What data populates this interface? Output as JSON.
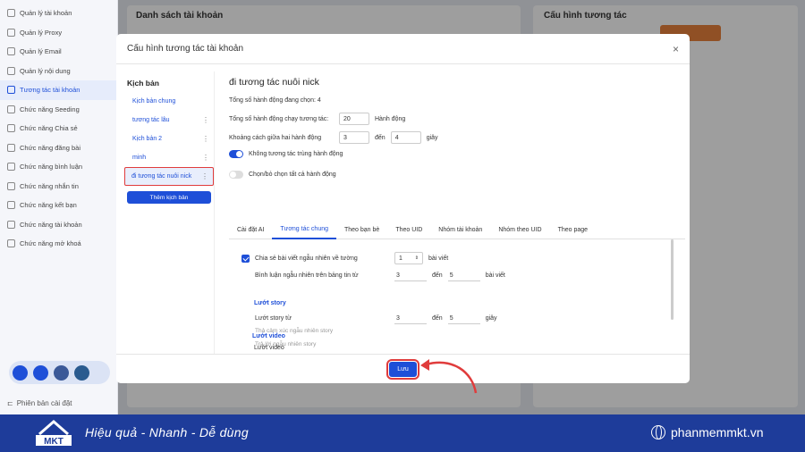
{
  "sidebar": {
    "items": [
      {
        "label": "Quản lý tài khoản",
        "icon": "user-icon"
      },
      {
        "label": "Quản lý Proxy",
        "icon": "proxy-icon"
      },
      {
        "label": "Quản lý Email",
        "icon": "mail-icon"
      },
      {
        "label": "Quản lý nội dung",
        "icon": "content-icon"
      },
      {
        "label": "Tương tác tài khoản",
        "icon": "interaction-icon",
        "active": true
      },
      {
        "label": "Chức năng Seeding",
        "icon": "seeding-icon"
      },
      {
        "label": "Chức năng Chia sẻ",
        "icon": "share-icon"
      },
      {
        "label": "Chức năng đăng bài",
        "icon": "post-icon"
      },
      {
        "label": "Chức năng bình luận",
        "icon": "comment-icon"
      },
      {
        "label": "Chức năng nhắn tin",
        "icon": "message-icon"
      },
      {
        "label": "Chức năng kết bạn",
        "icon": "friend-icon"
      },
      {
        "label": "Chức năng tài khoản",
        "icon": "account-icon"
      },
      {
        "label": "Chức năng mở khoá",
        "icon": "unlock-icon"
      }
    ],
    "version_label": "Phiên bản cài đặt"
  },
  "background": {
    "list_title": "Danh sách tài khoản",
    "config_title": "Cấu hình tương tác"
  },
  "modal": {
    "title": "Cấu hình tương tác tài khoản",
    "close": "×",
    "scripts_title": "Kịch bản",
    "scripts": [
      {
        "label": "Kịch bản chung",
        "menu": ""
      },
      {
        "label": "tương tác lâu",
        "menu": "⋮"
      },
      {
        "label": "Kịch bản 2",
        "menu": "⋮"
      },
      {
        "label": "minh",
        "menu": "⋮"
      },
      {
        "label": "đi tương tác nuôi nick",
        "menu": "⋮"
      }
    ],
    "add_script_label": "Thêm kịch bản",
    "script_title": "đi tương tác nuôi nick",
    "total_selected": "Tổng số hành động đang chọn: 4",
    "total_run_label": "Tổng số hành động chạy tương tác:",
    "total_run_value": "20",
    "action_unit": "Hành động",
    "interval_label": "Khoảng cách giữa hai hành động",
    "interval_from": "3",
    "interval_to_label": "đến",
    "interval_to": "4",
    "interval_unit": "giây",
    "no_duplicate_label": "Không tương tác trùng hành động",
    "select_all_label": "Chọn/bỏ chọn tất cả hành động",
    "tabs": [
      "Cài đặt AI",
      "Tương tác chung",
      "Theo bạn bè",
      "Theo UID",
      "Nhóm tài khoản",
      "Nhóm theo UID",
      "Theo page"
    ],
    "share_label": "Chia sẻ bài viết ngẫu nhiên về tường",
    "share_value": "1",
    "share_unit": "bài viết",
    "comment_label": "Bình luận ngẫu nhiên trên bảng tin từ",
    "comment_from": "3",
    "comment_to_label": "đến",
    "comment_to": "5",
    "comment_unit": "bài viết",
    "story_section": "Lướt story",
    "story_label": "Lướt story từ",
    "story_from": "3",
    "story_to_label": "đến",
    "story_to": "5",
    "story_unit": "giây",
    "story_react": "Thả cảm xúc ngẫu nhiên story",
    "story_reply": "Trả lời ngẫu nhiên story",
    "video_section": "Lướt video",
    "video_label": "Lướt video",
    "save_label": "Lưu"
  },
  "banner": {
    "slogan": "Hiệu quả - Nhanh - Dễ dùng",
    "website": "phanmemmkt.vn",
    "logo_text": "MKT"
  },
  "colors": {
    "accent": "#1e4fd8",
    "highlight": "#e03c3c",
    "banner": "#1e3c9a"
  }
}
